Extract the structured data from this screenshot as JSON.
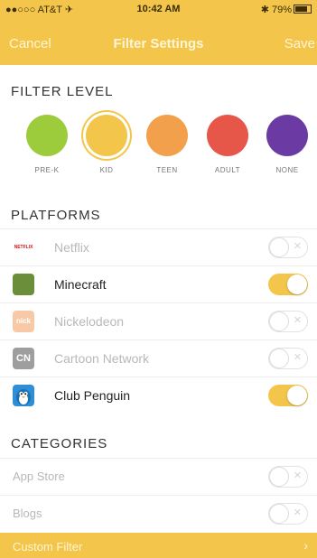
{
  "status": {
    "carrier": "●●○○○ AT&T ✈",
    "time": "10:42 AM",
    "battery": "✱ 79%"
  },
  "nav": {
    "cancel": "Cancel",
    "title": "Filter Settings",
    "save": "Save"
  },
  "filter_level": {
    "title": "FILTER LEVEL",
    "selected": "KID",
    "levels": [
      {
        "label": "PRE-K",
        "color": "#9ccb3b"
      },
      {
        "label": "KID",
        "color": "#f3c54a"
      },
      {
        "label": "TEEN",
        "color": "#f2a04b"
      },
      {
        "label": "ADULT",
        "color": "#e6574a"
      },
      {
        "label": "NONE",
        "color": "#6c3aa3"
      }
    ]
  },
  "platforms": {
    "title": "PLATFORMS",
    "items": [
      {
        "name": "Netflix",
        "logo_text": "NETFLIX",
        "logo_color": "#ffffff",
        "enabled": false
      },
      {
        "name": "Minecraft",
        "logo_text": "",
        "logo_color": "#6b8e3a",
        "enabled": true
      },
      {
        "name": "Nickelodeon",
        "logo_text": "nick",
        "logo_color": "#f8c9a6",
        "enabled": false
      },
      {
        "name": "Cartoon Network",
        "logo_text": "CN",
        "logo_color": "#9e9e9e",
        "enabled": false
      },
      {
        "name": "Club Penguin",
        "logo_text": "",
        "logo_color": "#2f8fd6",
        "enabled": true
      }
    ]
  },
  "categories": {
    "title": "CATEGORIES",
    "items": [
      {
        "name": "App Store",
        "enabled": false
      },
      {
        "name": "Blogs",
        "enabled": false
      }
    ]
  },
  "custom_filter": {
    "label": "Custom Filter",
    "chevron": "›"
  }
}
